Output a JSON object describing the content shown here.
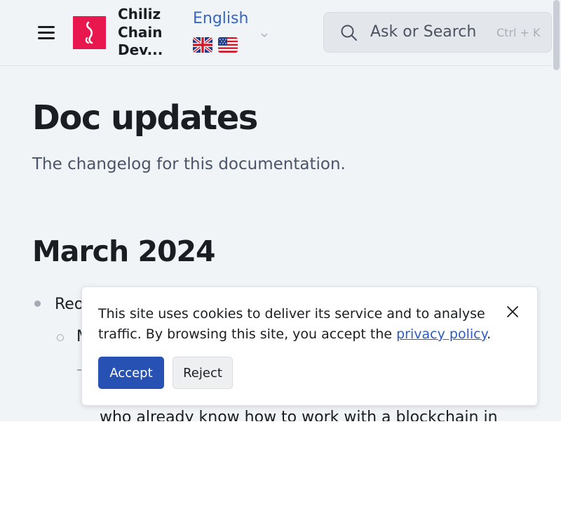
{
  "header": {
    "site_title": "Chiliz Chain Dev...",
    "language_label": "English",
    "flags": [
      "uk-flag-icon",
      "us-flag-icon"
    ],
    "search": {
      "label": "Ask or Search",
      "shortcut": "Ctrl + K"
    }
  },
  "main": {
    "title": "Doc updates",
    "subtitle": "The changelog for this documentation.",
    "section_title": "March 2024",
    "list": {
      "item_1_visible_text": "Reo",
      "subitem_1_visible_text": "M",
      "partial_paragraph_line": "who already know how to work with a blockchain in"
    }
  },
  "cookie_banner": {
    "text_before_link": "This site uses cookies to deliver its service and to analyse traffic. By browsing this site, you accept the ",
    "link_text": "privacy policy",
    "text_after_link": ".",
    "accept_label": "Accept",
    "reject_label": "Reject"
  },
  "colors": {
    "brand": "#e8174d",
    "link": "#3566c4",
    "accept_button": "#2752b4",
    "page_background": "#f1f4f7"
  }
}
